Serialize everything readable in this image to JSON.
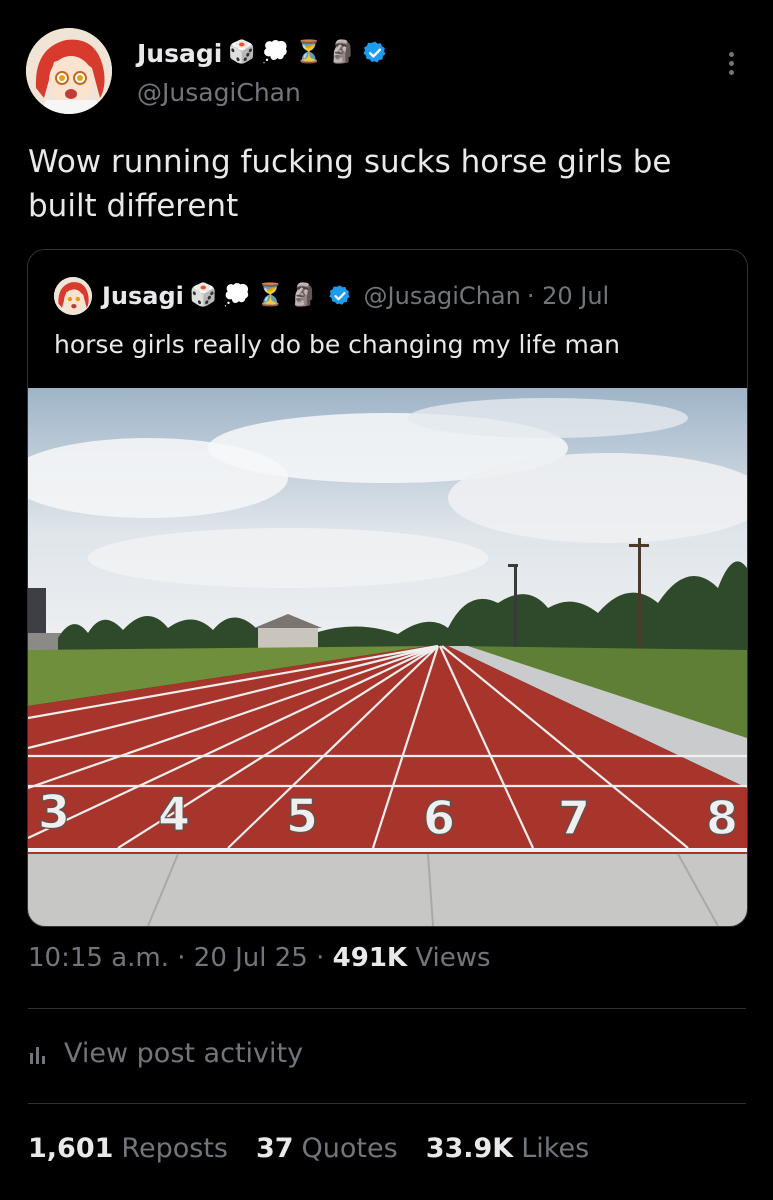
{
  "post": {
    "author": {
      "name": "Jusagi",
      "emojis": [
        "🎲",
        "💭",
        "⏳",
        "🗿"
      ],
      "handle": "@JusagiChan"
    },
    "text": "Wow running fucking sucks horse girls be built different",
    "quoted": {
      "name": "Jusagi",
      "emojis": [
        "🎲",
        "💭",
        "⏳",
        "🗿"
      ],
      "handle": "@JusagiChan",
      "date": "· 20 Jul",
      "text": "horse girls really do be changing my life man",
      "image_lane_numbers": [
        "3",
        "4",
        "5",
        "6",
        "7",
        "8"
      ]
    },
    "meta": {
      "time": "10:15 a.m.",
      "date": "20 Jul 25",
      "views_count": "491K",
      "views_label": "Views"
    },
    "activity_label": "View post activity",
    "stats": {
      "reposts_count": "1,601",
      "reposts_label": "Reposts",
      "quotes_count": "37",
      "quotes_label": "Quotes",
      "likes_count": "33.9K",
      "likes_label": "Likes"
    }
  },
  "colors": {
    "background": "#000000",
    "text": "#e7e9ea",
    "secondary": "#71767b",
    "verified": "#1d9bf0",
    "border": "#2f3336",
    "track": "#a8352b"
  },
  "icons": [
    "more-icon",
    "verified-icon",
    "bar-chart-icon"
  ]
}
